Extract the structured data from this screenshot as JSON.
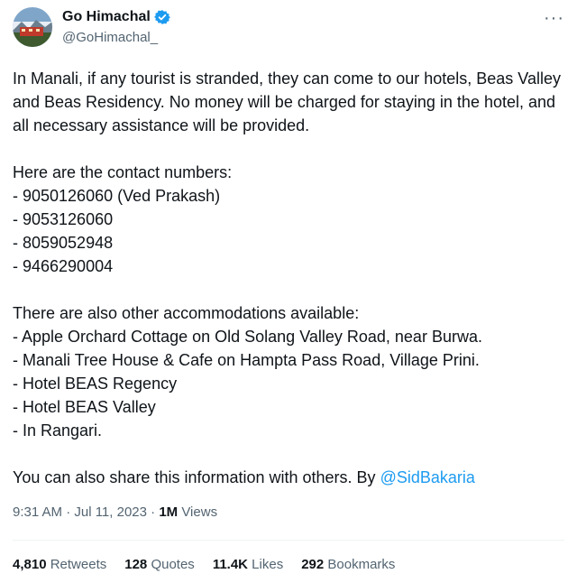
{
  "author": {
    "name": "Go Himachal",
    "handle": "@GoHimachal_"
  },
  "tweet": {
    "intro": "In Manali, if any tourist is stranded, they can come to our hotels, Beas Valley and Beas Residency. No money will be charged for staying in the hotel, and all necessary assistance will be provided.",
    "contacts_heading": "Here are the contact numbers:",
    "contacts": [
      "- 9050126060 (Ved Prakash)",
      "- 9053126060",
      "- 8059052948",
      "- 9466290004"
    ],
    "accommodations_heading": "There are also other accommodations available:",
    "accommodations": [
      "- Apple Orchard Cottage on Old Solang Valley Road, near Burwa.",
      "- Manali Tree House & Cafe on Hampta Pass Road, Village Prini.",
      "- Hotel BEAS Regency",
      "- Hotel BEAS Valley",
      "- In Rangari."
    ],
    "closing": "You can also share this information with others. By ",
    "mention": "@SidBakaria"
  },
  "meta": {
    "timestamp": "9:31 AM · Jul 11, 2023 · ",
    "views_count": "1M",
    "views_label": " Views"
  },
  "stats": {
    "retweets_count": "4,810",
    "retweets_label": " Retweets",
    "quotes_count": "128",
    "quotes_label": " Quotes",
    "likes_count": "11.4K",
    "likes_label": " Likes",
    "bookmarks_count": "292",
    "bookmarks_label": " Bookmarks"
  },
  "colors": {
    "accent": "#1d9bf0",
    "secondary_text": "#536471"
  },
  "icons": {
    "verified": "verified-badge-icon",
    "more": "more-options-icon"
  }
}
